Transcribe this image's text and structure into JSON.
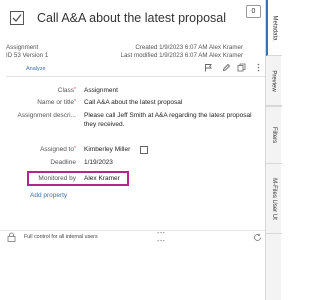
{
  "header": {
    "title": "Call A&A about the latest proposal",
    "count_badge": "0"
  },
  "meta": {
    "object_type": "Assignment",
    "id_version": "ID 53  Version 1",
    "created": "Created 1/9/2023 6:07 AM Alex Kramer",
    "last_modified": "Last modified 1/9/2023 6:07 AM Alex Kramer",
    "analyze_label": "Analyze"
  },
  "properties": [
    {
      "label": "Class",
      "required": true,
      "value": "Assignment"
    },
    {
      "label": "Name or title",
      "required": true,
      "value": "Call A&A about the latest proposal"
    },
    {
      "label": "Assignment descri...",
      "required": false,
      "value": "Please call Jeff Smith at A&A regarding the latest proposal"
    },
    {
      "label": "",
      "required": false,
      "value": "they received."
    },
    {
      "label": "Assigned to",
      "required": true,
      "value": "Kimberley Miller"
    },
    {
      "label": "Deadline",
      "required": false,
      "value": "1/19/2023"
    },
    {
      "label": "Monitored by",
      "required": false,
      "value": "Alex Kramer"
    }
  ],
  "add_property_label": "Add property",
  "footer": {
    "permissions": "Full control for all internal users",
    "dots_top": "---",
    "dots_bottom": "---"
  },
  "side_tabs": [
    {
      "label": "Metadata"
    },
    {
      "label": "Preview"
    },
    {
      "label": "Filters"
    },
    {
      "label": "M-Files User Ut"
    }
  ],
  "colors": {
    "accent": "#3a6fb0",
    "highlight_border": "#b2278d",
    "required_star": "#dd4444"
  }
}
